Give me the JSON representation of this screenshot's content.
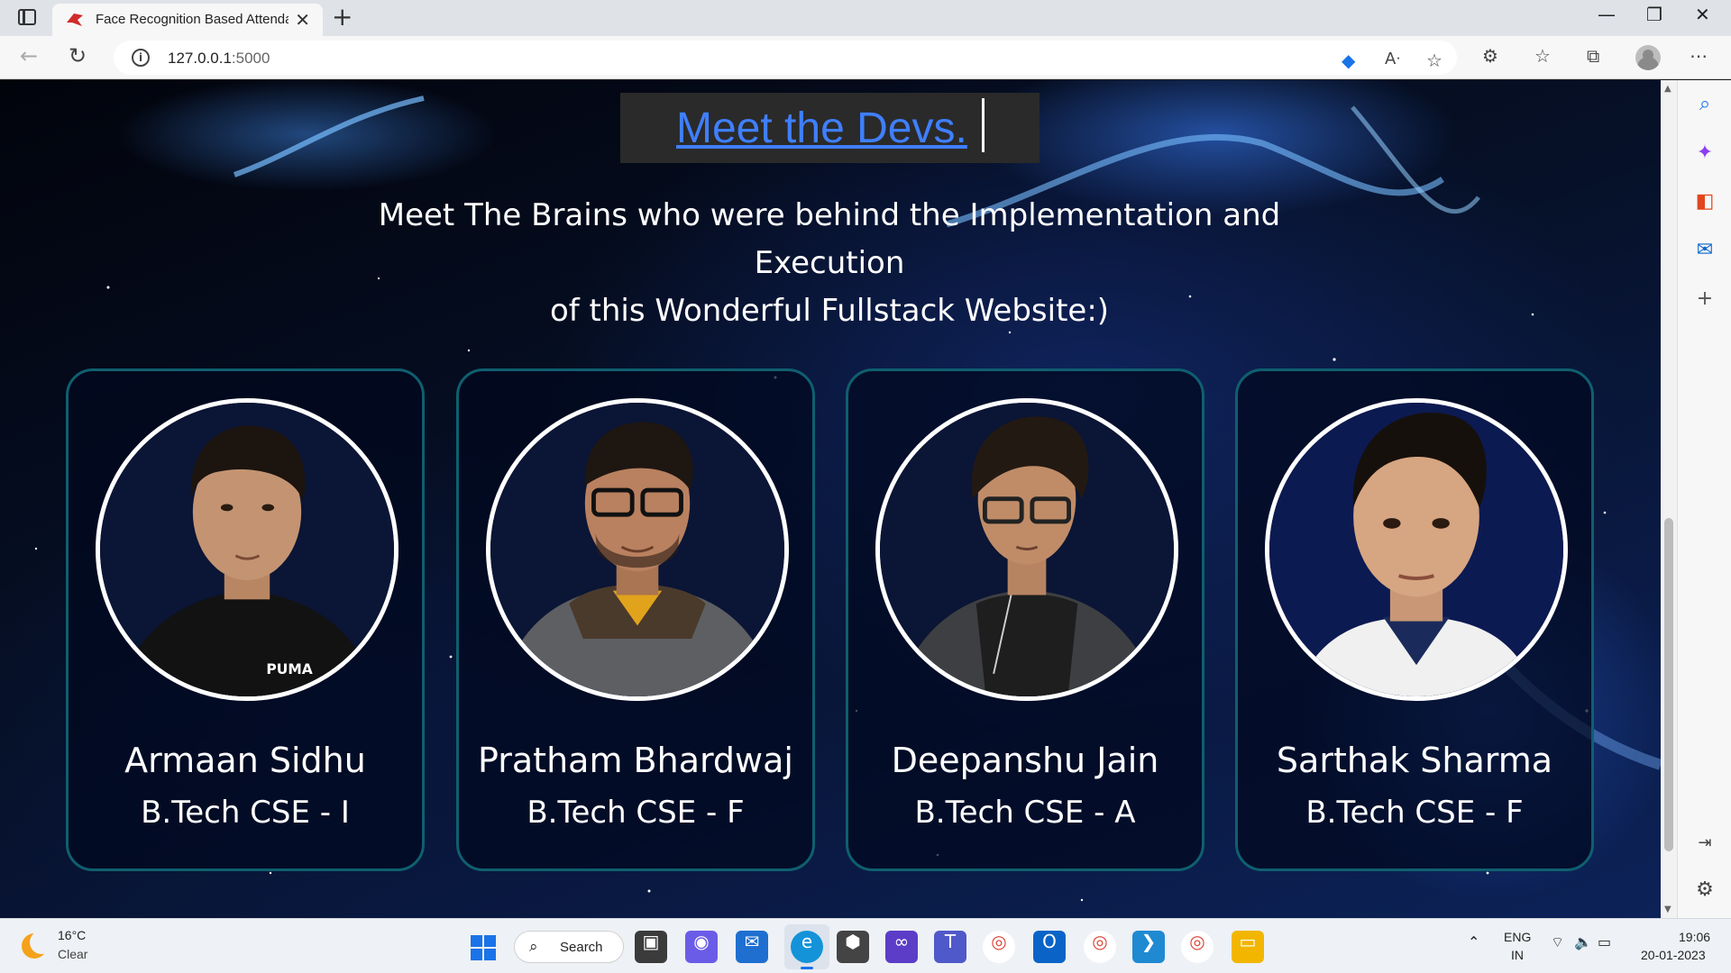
{
  "browser": {
    "tab_title": "Face Recognition Based Attendar",
    "url_host": "127.0.0.1",
    "url_port": ":5000"
  },
  "page": {
    "heading": "Meet the Devs.",
    "intro_line1": "Meet The Brains who were behind the Implementation and Execution",
    "intro_line2": "of this Wonderful Fullstack Website:)",
    "devs": [
      {
        "name": "Armaan Sidhu",
        "class": "B.Tech CSE - I",
        "shirt_text": "PUMA"
      },
      {
        "name": "Pratham Bhardwaj",
        "class": "B.Tech CSE - F"
      },
      {
        "name": "Deepanshu Jain",
        "class": "B.Tech CSE - A"
      },
      {
        "name": "Sarthak Sharma",
        "class": "B.Tech CSE - F"
      }
    ],
    "colors": {
      "link": "#3f7fff",
      "card_border": "#0f5f6f",
      "heading_bg": "#2a2a2a"
    }
  },
  "taskbar": {
    "weather_temp": "16°C",
    "weather_desc": "Clear",
    "search_label": "Search",
    "lang_line1": "ENG",
    "lang_line2": "IN",
    "time": "19:06",
    "date": "20-01-2023",
    "apps": [
      "file-explorer-icon",
      "meet-icon",
      "mail-icon",
      "edge-icon",
      "cube-icon",
      "visual-studio-icon",
      "teams-icon",
      "chrome-icon",
      "outlook-icon",
      "chrome-profile-r-icon",
      "vscode-icon",
      "chrome-profile-p-icon",
      "folder-icon"
    ]
  }
}
